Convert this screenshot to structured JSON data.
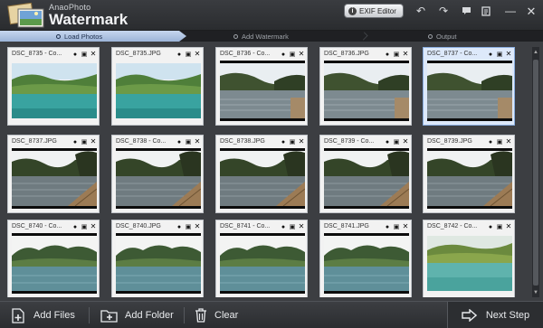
{
  "app": {
    "brand": "AnaoPhoto",
    "title": "Watermark"
  },
  "toolbar": {
    "exif_label": "EXIF Editor",
    "icons": [
      "undo-icon",
      "redo-icon",
      "feedback-icon",
      "register-icon",
      "minimize-icon",
      "close-icon"
    ]
  },
  "steps": [
    {
      "label": "Load Photos",
      "active": true
    },
    {
      "label": "Add Watermark",
      "active": false
    },
    {
      "label": "Output",
      "active": false
    }
  ],
  "photos": [
    {
      "name": "DSC_8735 - Co...",
      "scene": "green",
      "selected": false,
      "letterbox": false
    },
    {
      "name": "DSC_8735.JPG",
      "scene": "green",
      "selected": false,
      "letterbox": false
    },
    {
      "name": "DSC_8736 - Co...",
      "scene": "dusk",
      "selected": false,
      "letterbox": true
    },
    {
      "name": "DSC_8736.JPG",
      "scene": "dusk",
      "selected": false,
      "letterbox": true
    },
    {
      "name": "DSC_8737 - Co...",
      "scene": "dusk",
      "selected": true,
      "letterbox": true
    },
    {
      "name": "DSC_8737.JPG",
      "scene": "dock",
      "selected": false,
      "letterbox": true
    },
    {
      "name": "DSC_8738 - Co...",
      "scene": "dock",
      "selected": false,
      "letterbox": true
    },
    {
      "name": "DSC_8738.JPG",
      "scene": "dock",
      "selected": false,
      "letterbox": true
    },
    {
      "name": "DSC_8739 - Co...",
      "scene": "dock",
      "selected": false,
      "letterbox": true
    },
    {
      "name": "DSC_8739.JPG",
      "scene": "dock",
      "selected": false,
      "letterbox": true
    },
    {
      "name": "DSC_8740 - Co...",
      "scene": "mountain",
      "selected": false,
      "letterbox": true
    },
    {
      "name": "DSC_8740.JPG",
      "scene": "mountain",
      "selected": false,
      "letterbox": true
    },
    {
      "name": "DSC_8741 - Co...",
      "scene": "mountain",
      "selected": false,
      "letterbox": true
    },
    {
      "name": "DSC_8741.JPG",
      "scene": "mountain",
      "selected": false,
      "letterbox": true
    },
    {
      "name": "DSC_8742 - Co...",
      "scene": "lake",
      "selected": false,
      "letterbox": false
    }
  ],
  "bottom": {
    "add_files": "Add Files",
    "add_folder": "Add Folder",
    "clear": "Clear",
    "next_step": "Next Step"
  },
  "colors": {
    "background": "#3c3e42",
    "active_step": "#b4c8e6",
    "thumb_selected": "#dde9fa"
  }
}
